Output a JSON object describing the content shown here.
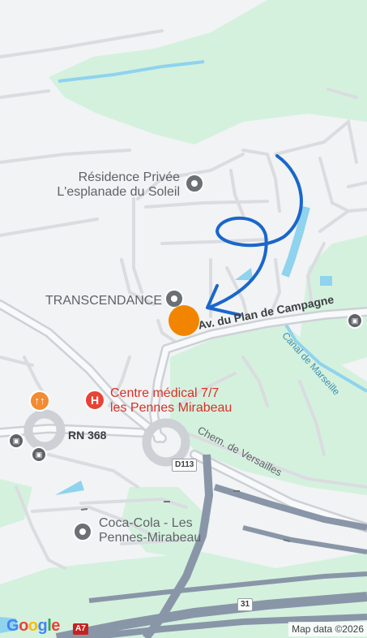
{
  "map": {
    "places": {
      "residence_line1": "Résidence Privée",
      "residence_line2": "L'esplanade du Soleil",
      "transcendance": "TRANSCENDANCE",
      "centre_line1": "Centre médical 7/7",
      "centre_line2": "les Pennes Mirabeau",
      "coca_line1": "Coca-Cola - Les",
      "coca_line2": "Pennes-Mirabeau"
    },
    "roads": {
      "plan_campagne": "Av. du Plan de Campagne",
      "rn368": "RN 368",
      "versailles": "Chem. de Versailles",
      "canal": "Canal de Marseille",
      "d113": "D113",
      "a31": "31",
      "a7": "A7"
    },
    "footer": {
      "google": "Google",
      "attribution": "Map data ©2026"
    },
    "colors": {
      "background": "#f1f3f4",
      "green": "#d4f1de",
      "water": "#8fd3ee",
      "road": "#dadce0",
      "highway": "#8996a8",
      "route": "#1a66cc",
      "location": "#f28500"
    }
  }
}
